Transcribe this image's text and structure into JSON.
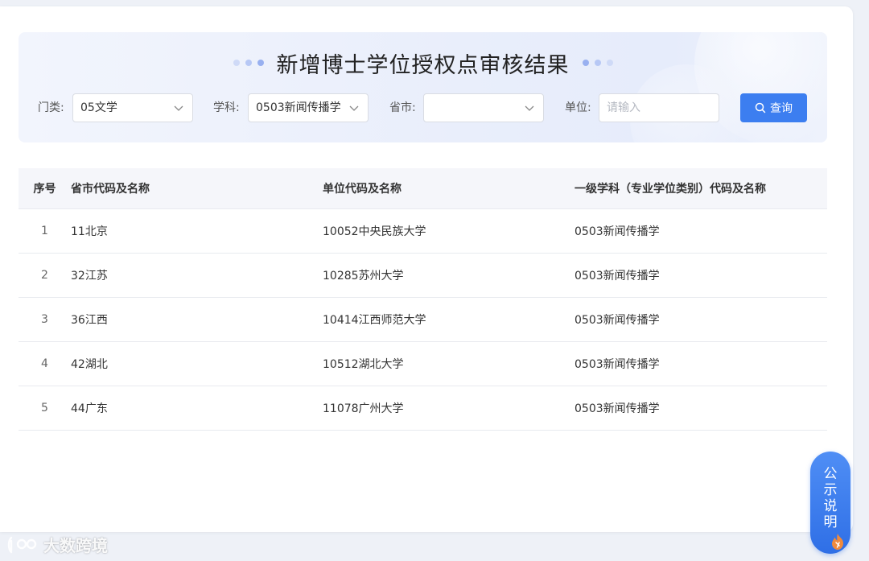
{
  "header": {
    "title": "新增博士学位授权点审核结果"
  },
  "filters": {
    "category_label": "门类:",
    "category_value": "05文学",
    "subject_label": "学科:",
    "subject_value": "0503新闻传播学",
    "province_label": "省市:",
    "province_value": "",
    "unit_label": "单位:",
    "unit_placeholder": "请输入",
    "query_label": "查询"
  },
  "table": {
    "headers": [
      "序号",
      "省市代码及名称",
      "单位代码及名称",
      "一级学科（专业学位类别）代码及名称"
    ],
    "rows": [
      [
        "1",
        "11北京",
        "10052中央民族大学",
        "0503新闻传播学"
      ],
      [
        "2",
        "32江苏",
        "10285苏州大学",
        "0503新闻传播学"
      ],
      [
        "3",
        "36江西",
        "10414江西师范大学",
        "0503新闻传播学"
      ],
      [
        "4",
        "42湖北",
        "10512湖北大学",
        "0503新闻传播学"
      ],
      [
        "5",
        "44广东",
        "11078广州大学",
        "0503新闻传播学"
      ]
    ]
  },
  "floating": {
    "notice_lines": [
      "公",
      "示",
      "说",
      "明"
    ]
  },
  "watermark": {
    "text": "大数跨境"
  },
  "colors": {
    "accent": "#3c7ef0",
    "panel_bg": "#eaeffb"
  }
}
